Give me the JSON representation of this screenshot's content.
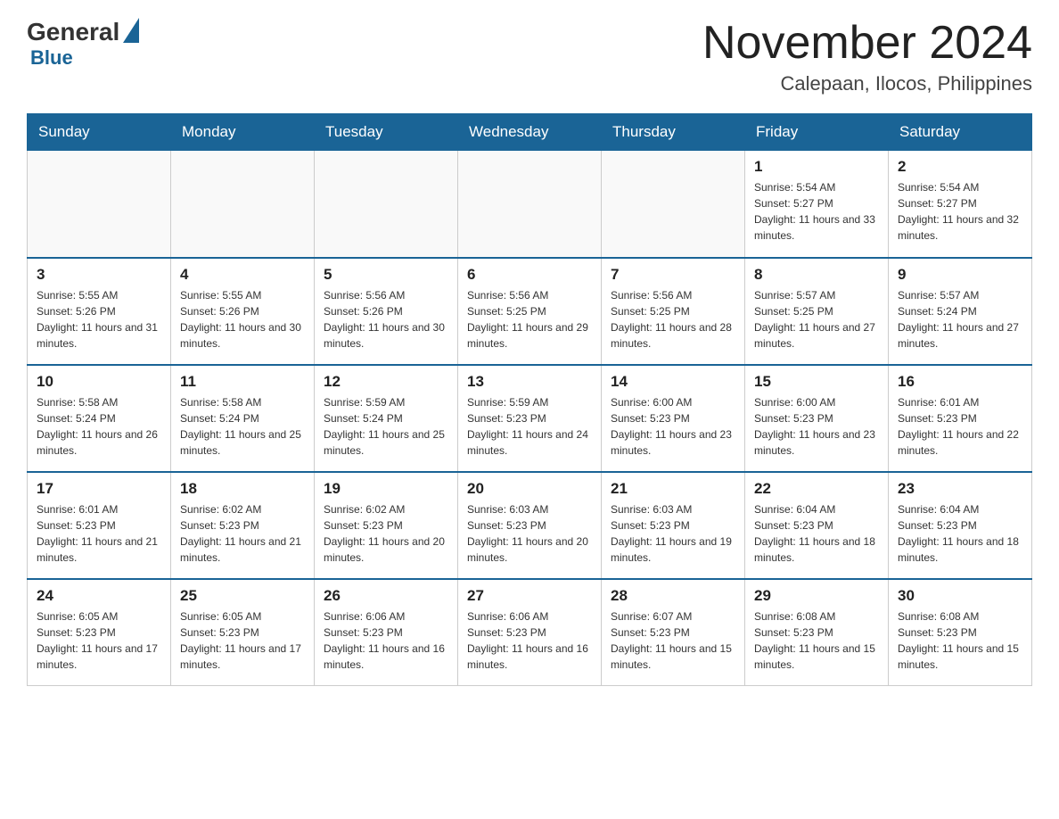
{
  "header": {
    "logo_general": "General",
    "logo_blue": "Blue",
    "month_title": "November 2024",
    "location": "Calepaan, Ilocos, Philippines"
  },
  "weekdays": [
    "Sunday",
    "Monday",
    "Tuesday",
    "Wednesday",
    "Thursday",
    "Friday",
    "Saturday"
  ],
  "weeks": [
    [
      {
        "day": "",
        "info": ""
      },
      {
        "day": "",
        "info": ""
      },
      {
        "day": "",
        "info": ""
      },
      {
        "day": "",
        "info": ""
      },
      {
        "day": "",
        "info": ""
      },
      {
        "day": "1",
        "info": "Sunrise: 5:54 AM\nSunset: 5:27 PM\nDaylight: 11 hours and 33 minutes."
      },
      {
        "day": "2",
        "info": "Sunrise: 5:54 AM\nSunset: 5:27 PM\nDaylight: 11 hours and 32 minutes."
      }
    ],
    [
      {
        "day": "3",
        "info": "Sunrise: 5:55 AM\nSunset: 5:26 PM\nDaylight: 11 hours and 31 minutes."
      },
      {
        "day": "4",
        "info": "Sunrise: 5:55 AM\nSunset: 5:26 PM\nDaylight: 11 hours and 30 minutes."
      },
      {
        "day": "5",
        "info": "Sunrise: 5:56 AM\nSunset: 5:26 PM\nDaylight: 11 hours and 30 minutes."
      },
      {
        "day": "6",
        "info": "Sunrise: 5:56 AM\nSunset: 5:25 PM\nDaylight: 11 hours and 29 minutes."
      },
      {
        "day": "7",
        "info": "Sunrise: 5:56 AM\nSunset: 5:25 PM\nDaylight: 11 hours and 28 minutes."
      },
      {
        "day": "8",
        "info": "Sunrise: 5:57 AM\nSunset: 5:25 PM\nDaylight: 11 hours and 27 minutes."
      },
      {
        "day": "9",
        "info": "Sunrise: 5:57 AM\nSunset: 5:24 PM\nDaylight: 11 hours and 27 minutes."
      }
    ],
    [
      {
        "day": "10",
        "info": "Sunrise: 5:58 AM\nSunset: 5:24 PM\nDaylight: 11 hours and 26 minutes."
      },
      {
        "day": "11",
        "info": "Sunrise: 5:58 AM\nSunset: 5:24 PM\nDaylight: 11 hours and 25 minutes."
      },
      {
        "day": "12",
        "info": "Sunrise: 5:59 AM\nSunset: 5:24 PM\nDaylight: 11 hours and 25 minutes."
      },
      {
        "day": "13",
        "info": "Sunrise: 5:59 AM\nSunset: 5:23 PM\nDaylight: 11 hours and 24 minutes."
      },
      {
        "day": "14",
        "info": "Sunrise: 6:00 AM\nSunset: 5:23 PM\nDaylight: 11 hours and 23 minutes."
      },
      {
        "day": "15",
        "info": "Sunrise: 6:00 AM\nSunset: 5:23 PM\nDaylight: 11 hours and 23 minutes."
      },
      {
        "day": "16",
        "info": "Sunrise: 6:01 AM\nSunset: 5:23 PM\nDaylight: 11 hours and 22 minutes."
      }
    ],
    [
      {
        "day": "17",
        "info": "Sunrise: 6:01 AM\nSunset: 5:23 PM\nDaylight: 11 hours and 21 minutes."
      },
      {
        "day": "18",
        "info": "Sunrise: 6:02 AM\nSunset: 5:23 PM\nDaylight: 11 hours and 21 minutes."
      },
      {
        "day": "19",
        "info": "Sunrise: 6:02 AM\nSunset: 5:23 PM\nDaylight: 11 hours and 20 minutes."
      },
      {
        "day": "20",
        "info": "Sunrise: 6:03 AM\nSunset: 5:23 PM\nDaylight: 11 hours and 20 minutes."
      },
      {
        "day": "21",
        "info": "Sunrise: 6:03 AM\nSunset: 5:23 PM\nDaylight: 11 hours and 19 minutes."
      },
      {
        "day": "22",
        "info": "Sunrise: 6:04 AM\nSunset: 5:23 PM\nDaylight: 11 hours and 18 minutes."
      },
      {
        "day": "23",
        "info": "Sunrise: 6:04 AM\nSunset: 5:23 PM\nDaylight: 11 hours and 18 minutes."
      }
    ],
    [
      {
        "day": "24",
        "info": "Sunrise: 6:05 AM\nSunset: 5:23 PM\nDaylight: 11 hours and 17 minutes."
      },
      {
        "day": "25",
        "info": "Sunrise: 6:05 AM\nSunset: 5:23 PM\nDaylight: 11 hours and 17 minutes."
      },
      {
        "day": "26",
        "info": "Sunrise: 6:06 AM\nSunset: 5:23 PM\nDaylight: 11 hours and 16 minutes."
      },
      {
        "day": "27",
        "info": "Sunrise: 6:06 AM\nSunset: 5:23 PM\nDaylight: 11 hours and 16 minutes."
      },
      {
        "day": "28",
        "info": "Sunrise: 6:07 AM\nSunset: 5:23 PM\nDaylight: 11 hours and 15 minutes."
      },
      {
        "day": "29",
        "info": "Sunrise: 6:08 AM\nSunset: 5:23 PM\nDaylight: 11 hours and 15 minutes."
      },
      {
        "day": "30",
        "info": "Sunrise: 6:08 AM\nSunset: 5:23 PM\nDaylight: 11 hours and 15 minutes."
      }
    ]
  ]
}
